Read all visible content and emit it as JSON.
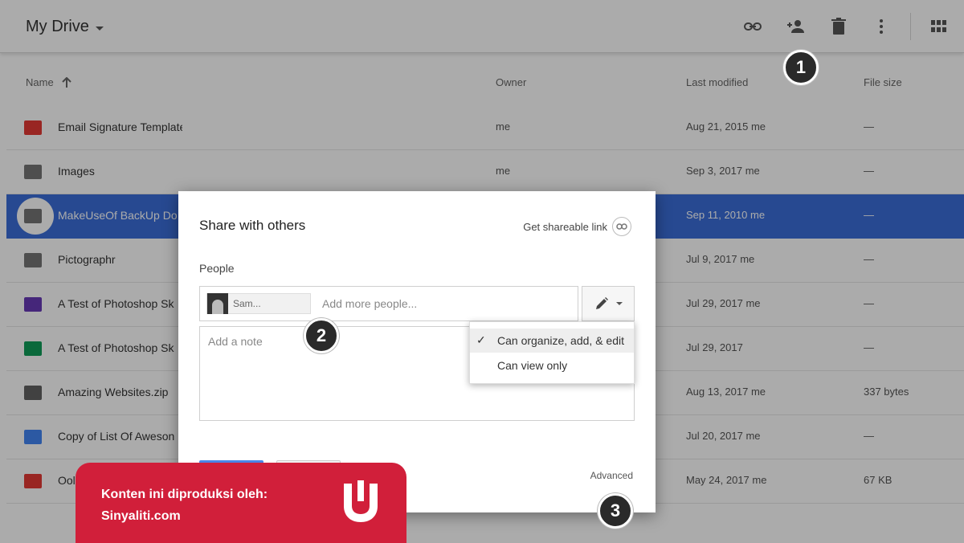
{
  "header": {
    "title": "My Drive",
    "icons": [
      "link-icon",
      "add-person-icon",
      "trash-icon",
      "more-vert-icon",
      "grid-view-icon"
    ]
  },
  "table": {
    "columns": {
      "name": "Name",
      "owner": "Owner",
      "modified": "Last modified",
      "size": "File size"
    },
    "rows": [
      {
        "name": "Email Signature Templates",
        "owner": "me",
        "modified": "Aug 21, 2015 me",
        "size": "—",
        "icon": "shared-folder-icon",
        "color": "#e53935"
      },
      {
        "name": "Images",
        "owner": "me",
        "modified": "Sep 3, 2017 me",
        "size": "—",
        "icon": "folder-icon",
        "color": "#757575"
      },
      {
        "name": "MakeUseOf BackUp Do",
        "owner": "",
        "modified": "Sep 11, 2010 me",
        "size": "—",
        "icon": "folder-icon",
        "color": "#757575"
      },
      {
        "name": "Pictographr",
        "owner": "",
        "modified": "Jul 9, 2017 me",
        "size": "—",
        "icon": "folder-icon",
        "color": "#757575"
      },
      {
        "name": "A Test of Photoshop Sk",
        "owner": "",
        "modified": "Jul 29, 2017 me",
        "size": "—",
        "icon": "forms-icon",
        "color": "#673ab7"
      },
      {
        "name": "A Test of Photoshop Sk",
        "owner": "",
        "modified": "Jul 29, 2017",
        "size": "—",
        "icon": "sheets-icon",
        "color": "#0f9d58"
      },
      {
        "name": "Amazing Websites.zip",
        "owner": "",
        "modified": "Aug 13, 2017 me",
        "size": "337 bytes",
        "icon": "archive-icon",
        "color": "#616161"
      },
      {
        "name": "Copy of List Of Aweson",
        "owner": "",
        "modified": "Jul 20, 2017 me",
        "size": "—",
        "icon": "docs-icon",
        "color": "#4285f4"
      },
      {
        "name": "Ool",
        "owner": "",
        "modified": "May 24, 2017 me",
        "size": "67 KB",
        "icon": "pdf-icon",
        "color": "#e53935"
      }
    ],
    "selected_index": 2
  },
  "dialog": {
    "title": "Share with others",
    "shareable_link": "Get shareable link",
    "people_label": "People",
    "chip_text": "Sam...",
    "people_placeholder": "Add more people...",
    "note_placeholder": "Add a note",
    "permissions": [
      {
        "label": "Can organize, add, & edit",
        "checked": true
      },
      {
        "label": "Can view only",
        "checked": false
      }
    ],
    "check_mark": "✓",
    "advanced": "Advanced"
  },
  "callouts": [
    "1",
    "2",
    "3"
  ],
  "banner": {
    "line1": "Konten ini diproduksi oleh:",
    "line2": "Sinyaliti.com",
    "bg_color": "#d11f3a"
  }
}
